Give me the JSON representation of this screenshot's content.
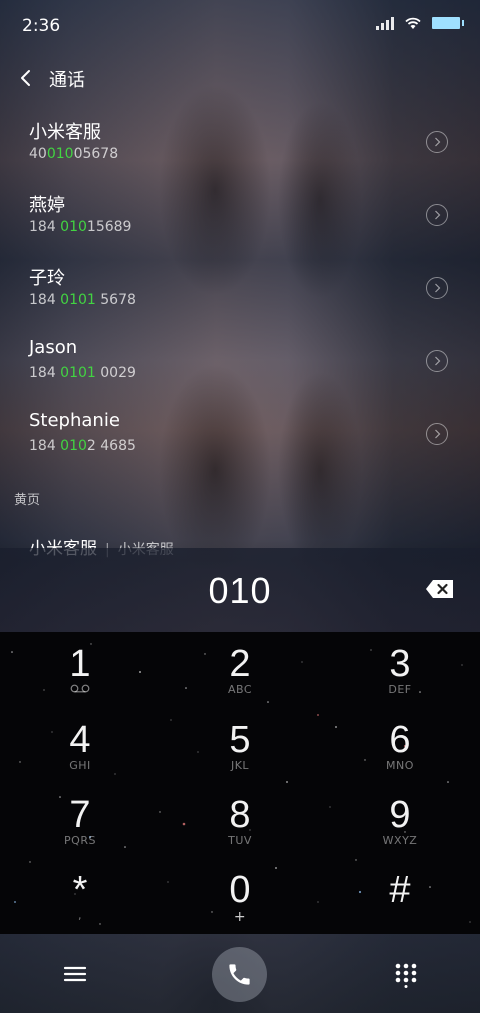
{
  "status_bar": {
    "time": "2:36",
    "icons": [
      "signal-icon",
      "wifi-icon",
      "battery-icon"
    ]
  },
  "header": {
    "title": "通话",
    "back_icon": "chevron-left-icon"
  },
  "contacts": [
    {
      "name": "小米客服",
      "number_pre": "40",
      "number_match": "010",
      "number_post": "05678"
    },
    {
      "name": "燕婷",
      "number_pre": "184 ",
      "number_match": "010",
      "number_post": "15689"
    },
    {
      "name": "子玲",
      "number_pre": "184 ",
      "number_match": "0101",
      "number_post": " 5678"
    },
    {
      "name": "Jason",
      "number_pre": "184 ",
      "number_match": "0101",
      "number_post": " 0029"
    },
    {
      "name": "Stephanie",
      "number_pre": "184 ",
      "number_match": "010",
      "number_post": "2 4685"
    }
  ],
  "yellow_pages": {
    "section_label": "黄页",
    "name": "小米客服",
    "separator": "|",
    "subtitle": "小米客服"
  },
  "dial_input": {
    "value": "010"
  },
  "keypad": [
    {
      "digit": "1",
      "letters": ""
    },
    {
      "digit": "2",
      "letters": "ABC"
    },
    {
      "digit": "3",
      "letters": "DEF"
    },
    {
      "digit": "4",
      "letters": "GHI"
    },
    {
      "digit": "5",
      "letters": "JKL"
    },
    {
      "digit": "6",
      "letters": "MNO"
    },
    {
      "digit": "7",
      "letters": "PQRS"
    },
    {
      "digit": "8",
      "letters": "TUV"
    },
    {
      "digit": "9",
      "letters": "WXYZ"
    },
    {
      "digit": "*",
      "letters": ","
    },
    {
      "digit": "0",
      "letters": "+"
    },
    {
      "digit": "#",
      "letters": ""
    }
  ],
  "colors": {
    "match_highlight": "#42d442",
    "battery": "#9fe0ff"
  }
}
